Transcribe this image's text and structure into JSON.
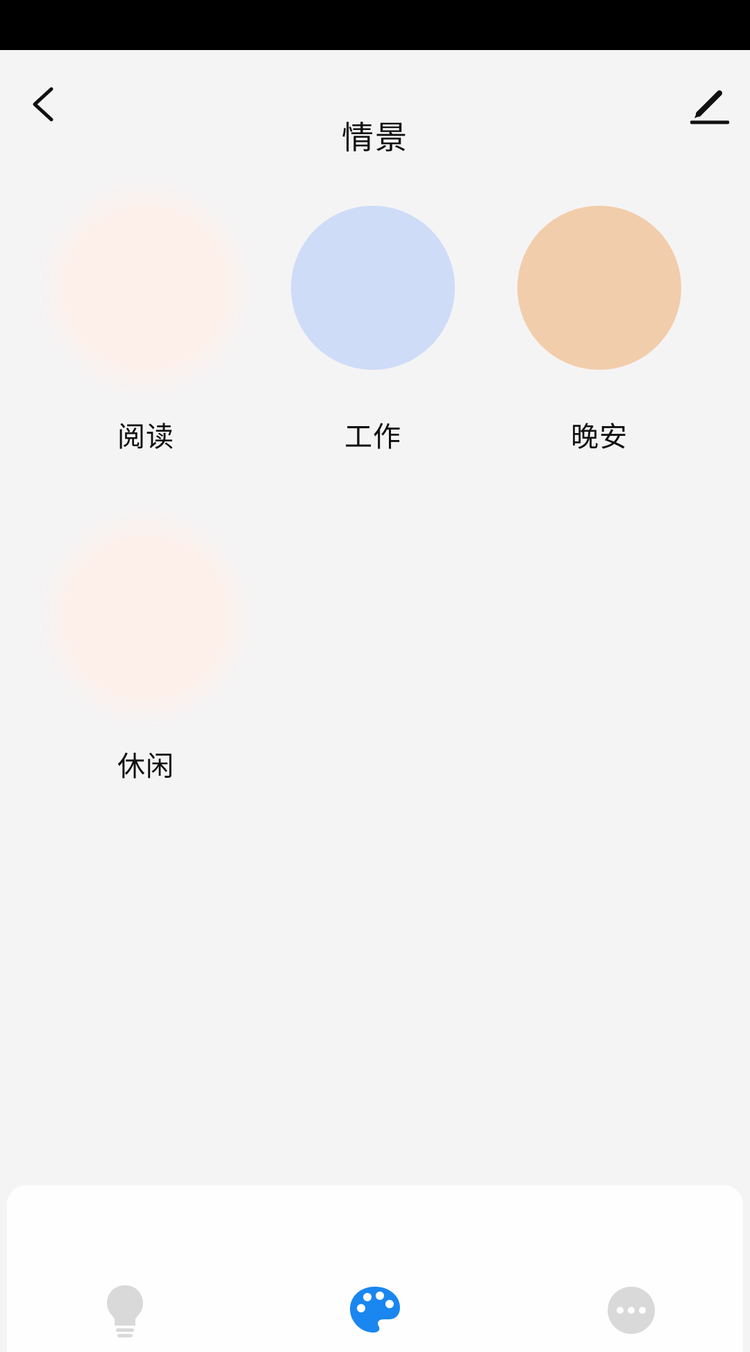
{
  "header": {
    "title": "情景",
    "back_icon": "chevron-left-icon",
    "edit_icon": "pencil-icon"
  },
  "scenes": [
    {
      "label": "阅读",
      "color": "#fdf0ea"
    },
    {
      "label": "工作",
      "color": "#cedcf8"
    },
    {
      "label": "晚安",
      "color": "#f2cdab"
    },
    {
      "label": "休闲",
      "color": "#fdf0ea"
    }
  ],
  "bottom_nav": {
    "items": [
      {
        "icon": "light-bulb-icon",
        "active": false,
        "color": "#d9d9d9"
      },
      {
        "icon": "palette-icon",
        "active": true,
        "color": "#1a86f0"
      },
      {
        "icon": "more-icon",
        "active": false,
        "color": "#d9d9d9"
      }
    ]
  }
}
